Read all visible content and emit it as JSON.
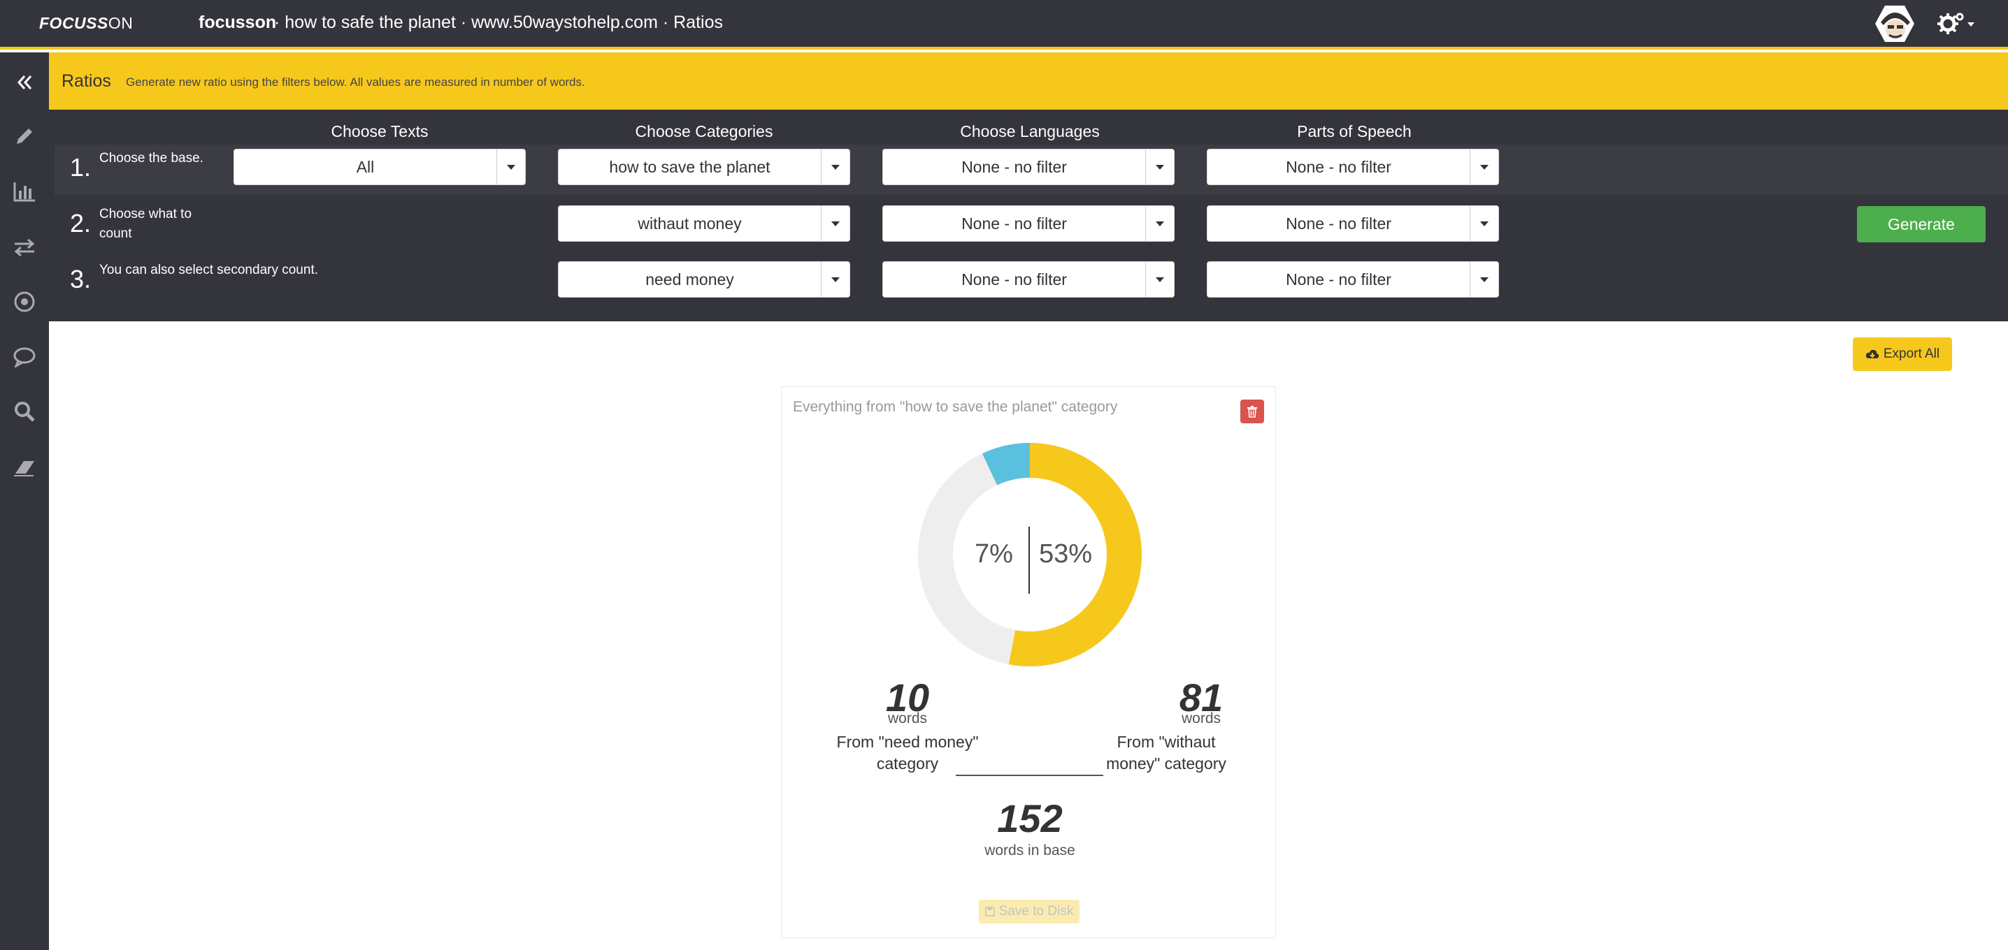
{
  "app": {
    "logo_part1": "FOCUSS",
    "logo_part2": "ON",
    "name": "focusson",
    "breadcrumb": "· how to safe the planet · www.50waystohelp.com · Ratios"
  },
  "sidebar": {
    "items": [
      "collapse-icon",
      "pencil-icon",
      "bar-chart-icon",
      "exchange-icon",
      "target-icon",
      "comment-icon",
      "search-icon",
      "eraser-icon"
    ]
  },
  "header": {
    "title": "Ratios",
    "subtitle": "Generate new ratio using the filters below. All values are measured in number of words."
  },
  "filters": {
    "columns": [
      "Choose Texts",
      "Choose Categories",
      "Choose Languages",
      "Parts of Speech"
    ],
    "steps": [
      {
        "num": "1.",
        "label": "Choose the base."
      },
      {
        "num": "2.",
        "label": "Choose what to count"
      },
      {
        "num": "3.",
        "label": "You can also select secondary count."
      }
    ],
    "row1": {
      "texts": "All",
      "categories": "how to save the planet",
      "languages": "None - no filter",
      "pos": "None - no filter"
    },
    "row2": {
      "categories": "withaut money",
      "languages": "None - no filter",
      "pos": "None - no filter"
    },
    "row3": {
      "categories": "need money",
      "languages": "None - no filter",
      "pos": "None - no filter"
    },
    "generate_label": "Generate"
  },
  "export_label": "Export All",
  "card": {
    "title": "Everything from \"how to save the planet\" category",
    "secondary_pct": "7%",
    "primary_pct": "53%",
    "secondary_fraction": 0.07,
    "primary_fraction": 0.53,
    "secondary_count": "10",
    "secondary_unit": "words",
    "secondary_desc": "From \"need money\" category",
    "primary_count": "81",
    "primary_unit": "words",
    "primary_desc": "From \"withaut money\" category",
    "base_count": "152",
    "base_desc": "words in base",
    "save_label": "Save to Disk"
  },
  "colors": {
    "accent": "#f7c81c",
    "dark": "#34343c",
    "primary_arc": "#f7c81c",
    "secondary_arc": "#5bc0de",
    "track": "#eeeeee",
    "generate": "#4cae4c",
    "delete": "#d9534f"
  }
}
